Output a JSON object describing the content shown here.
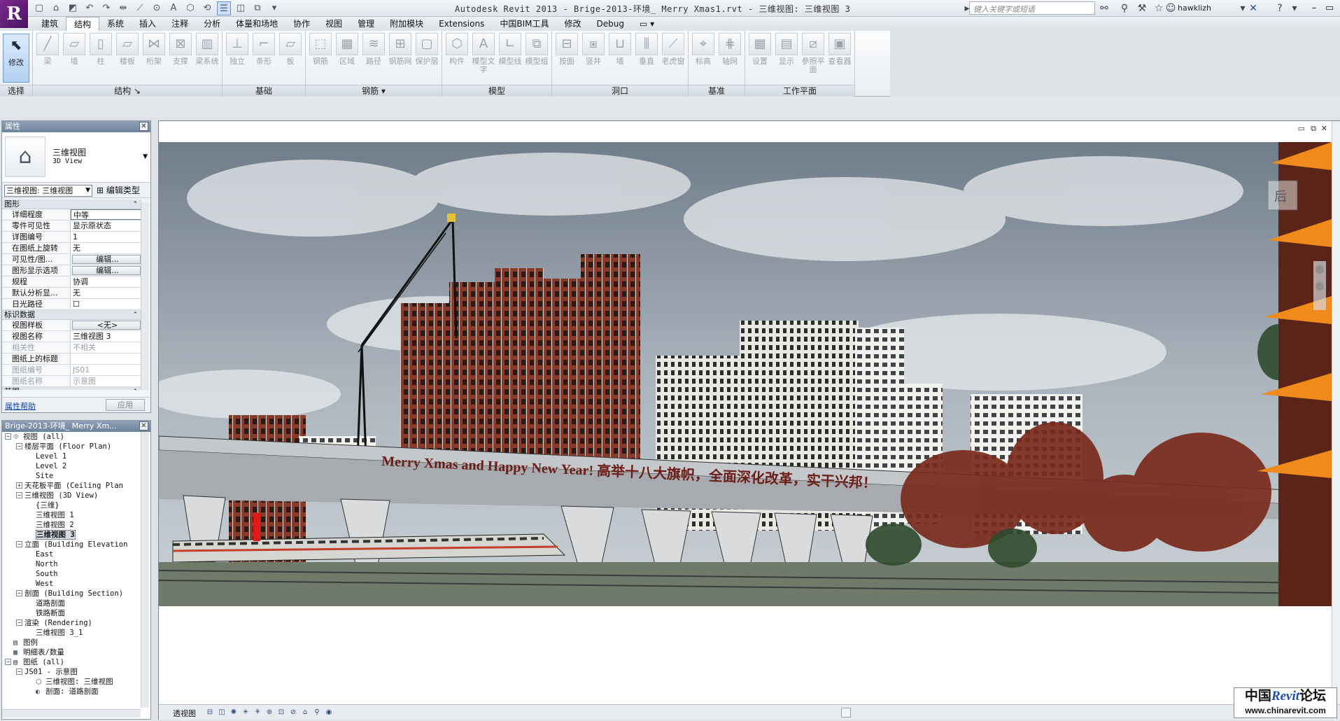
{
  "title_bar": {
    "logo_glyph": "R",
    "title": "Autodesk Revit 2013 -    Brige-2013-环境_ Merry Xmas1.rvt - 三维视图: 三维视图 3",
    "search_placeholder": "键入关键字或短语",
    "user": "hawklizh",
    "qat_icons": [
      "new-icon",
      "open-icon",
      "save-icon",
      "undo-icon",
      "redo-icon",
      "measure-icon",
      "text-icon",
      "3d-view-icon",
      "section-icon",
      "thin-lines-icon",
      "switch-windows-icon"
    ]
  },
  "ribbon_tabs": [
    "建筑",
    "结构",
    "系统",
    "插入",
    "注释",
    "分析",
    "体量和场地",
    "协作",
    "视图",
    "管理",
    "附加模块",
    "Extensions",
    "中国BIM工具",
    "修改",
    "Debug",
    "▭ ▾"
  ],
  "active_tab": "结构",
  "panels": [
    {
      "title": "选择",
      "tools": [
        {
          "label": "修改",
          "glyph": "⬉"
        }
      ]
    },
    {
      "title": "结构 ↘",
      "tools": [
        {
          "label": "梁",
          "glyph": "╱"
        },
        {
          "label": "墙",
          "glyph": "▱"
        },
        {
          "label": "柱",
          "glyph": "▯"
        },
        {
          "label": "楼板",
          "glyph": "▱"
        },
        {
          "label": "桁架",
          "glyph": "⋈"
        },
        {
          "label": "支撑",
          "glyph": "⊠"
        },
        {
          "label": "梁系统",
          "glyph": "▥"
        }
      ]
    },
    {
      "title": "基础",
      "tools": [
        {
          "label": "独立",
          "glyph": "⊥"
        },
        {
          "label": "条形",
          "glyph": "⌐"
        },
        {
          "label": "板",
          "glyph": "▱"
        }
      ]
    },
    {
      "title": "钢筋 ▾",
      "tools": [
        {
          "label": "钢筋",
          "glyph": "⬚"
        },
        {
          "label": "区域",
          "glyph": "▦"
        },
        {
          "label": "路径",
          "glyph": "≋"
        },
        {
          "label": "钢筋网",
          "glyph": "⊞"
        },
        {
          "label": "保护层",
          "glyph": "▢"
        }
      ]
    },
    {
      "title": "模型",
      "tools": [
        {
          "label": "构件",
          "glyph": "⬡"
        },
        {
          "label": "模型文字",
          "glyph": "A"
        },
        {
          "label": "模型线",
          "glyph": "∟"
        },
        {
          "label": "模型组",
          "glyph": "⧉"
        }
      ]
    },
    {
      "title": "洞口",
      "tools": [
        {
          "label": "按面",
          "glyph": "⊟"
        },
        {
          "label": "竖井",
          "glyph": "⧆"
        },
        {
          "label": "墙",
          "glyph": "⊔"
        },
        {
          "label": "垂直",
          "glyph": "⫼"
        },
        {
          "label": "老虎窗",
          "glyph": "⟋"
        }
      ]
    },
    {
      "title": "基准",
      "tools": [
        {
          "label": "标高",
          "glyph": "⌖"
        },
        {
          "label": "轴网",
          "glyph": "⋕"
        }
      ]
    },
    {
      "title": "工作平面",
      "tools": [
        {
          "label": "设置",
          "glyph": "▦"
        },
        {
          "label": "显示",
          "glyph": "▤"
        },
        {
          "label": "参照平面",
          "glyph": "⧄"
        },
        {
          "label": "查看器",
          "glyph": "▣"
        }
      ]
    }
  ],
  "properties": {
    "header": "属性",
    "type_name": "三维视图",
    "type_sub": "3D View",
    "view_select": "三维视图: 三维视图",
    "edit_type": "编辑类型",
    "sections": [
      {
        "name": "图形",
        "rows": [
          {
            "name": "详细程度",
            "value": "中等",
            "style": "edit"
          },
          {
            "name": "零件可见性",
            "value": "显示原状态"
          },
          {
            "name": "详图编号",
            "value": "1"
          },
          {
            "name": "在图纸上旋转",
            "value": "无"
          },
          {
            "name": "可见性/图...",
            "value": "编辑...",
            "style": "btn"
          },
          {
            "name": "图形显示选项",
            "value": "编辑...",
            "style": "btn"
          },
          {
            "name": "规程",
            "value": "协调"
          },
          {
            "name": "默认分析显...",
            "value": "无"
          },
          {
            "name": "日光路径",
            "value": "☐"
          }
        ]
      },
      {
        "name": "标识数据",
        "rows": [
          {
            "name": "视图样板",
            "value": "<无>",
            "style": "btn"
          },
          {
            "name": "视图名称",
            "value": "三维视图 3"
          },
          {
            "name": "相关性",
            "value": "不相关",
            "style": "grey"
          },
          {
            "name": "图纸上的标题",
            "value": ""
          },
          {
            "name": "图纸编号",
            "value": "JS01",
            "style": "grey"
          },
          {
            "name": "图纸名称",
            "value": "示意图",
            "style": "grey"
          }
        ]
      },
      {
        "name": "范围",
        "rows": []
      }
    ],
    "help_link": "属性帮助",
    "apply": "应用"
  },
  "browser": {
    "header": "Brige-2013-环境_ Merry Xm...",
    "tree": [
      {
        "indent": 0,
        "toggle": "−",
        "icon": "⟐",
        "text": "视图 (all)"
      },
      {
        "indent": 1,
        "toggle": "−",
        "icon": "",
        "text": "楼层平面 (Floor Plan)"
      },
      {
        "indent": 2,
        "toggle": "",
        "icon": "",
        "text": "Level 1"
      },
      {
        "indent": 2,
        "toggle": "",
        "icon": "",
        "text": "Level 2"
      },
      {
        "indent": 2,
        "toggle": "",
        "icon": "",
        "text": "Site"
      },
      {
        "indent": 1,
        "toggle": "+",
        "icon": "",
        "text": "天花板平面 (Ceiling Plan"
      },
      {
        "indent": 1,
        "toggle": "−",
        "icon": "",
        "text": "三维视图 (3D View)"
      },
      {
        "indent": 2,
        "toggle": "",
        "icon": "",
        "text": "{三维}"
      },
      {
        "indent": 2,
        "toggle": "",
        "icon": "",
        "text": "三维视图 1"
      },
      {
        "indent": 2,
        "toggle": "",
        "icon": "",
        "text": "三维视图 2"
      },
      {
        "indent": 2,
        "toggle": "",
        "icon": "",
        "text": "三维视图 3",
        "selected": true
      },
      {
        "indent": 1,
        "toggle": "−",
        "icon": "",
        "text": "立面 (Building Elevation"
      },
      {
        "indent": 2,
        "toggle": "",
        "icon": "",
        "text": "East"
      },
      {
        "indent": 2,
        "toggle": "",
        "icon": "",
        "text": "North"
      },
      {
        "indent": 2,
        "toggle": "",
        "icon": "",
        "text": "South"
      },
      {
        "indent": 2,
        "toggle": "",
        "icon": "",
        "text": "West"
      },
      {
        "indent": 1,
        "toggle": "−",
        "icon": "",
        "text": "剖面 (Building Section)"
      },
      {
        "indent": 2,
        "toggle": "",
        "icon": "",
        "text": "道路剖面"
      },
      {
        "indent": 2,
        "toggle": "",
        "icon": "",
        "text": "铁路断面"
      },
      {
        "indent": 1,
        "toggle": "−",
        "icon": "",
        "text": "渲染 (Rendering)"
      },
      {
        "indent": 2,
        "toggle": "",
        "icon": "",
        "text": "三维视图 3_1"
      },
      {
        "indent": 0,
        "toggle": "",
        "icon": "▤",
        "text": "图例"
      },
      {
        "indent": 0,
        "toggle": "",
        "icon": "▦",
        "text": "明细表/数量"
      },
      {
        "indent": 0,
        "toggle": "−",
        "icon": "▤",
        "text": "图纸 (all)"
      },
      {
        "indent": 1,
        "toggle": "−",
        "icon": "",
        "text": "JS01 - 示意图"
      },
      {
        "indent": 2,
        "toggle": "",
        "icon": "⬡",
        "text": "三维视图: 三维视图"
      },
      {
        "indent": 2,
        "toggle": "",
        "icon": "◐",
        "text": "剖面: 道路剖面"
      }
    ]
  },
  "view": {
    "banner": "Merry Xmas and Happy New Year! 高举十八大旗帜，全面深化改革，实干兴邦！",
    "view_cube_label": "后",
    "status_view_name": "透视图",
    "status_icons": [
      "scale-icon",
      "detail-level-icon",
      "visual-style-icon",
      "sun-path-icon",
      "shadows-icon",
      "render-icon",
      "crop-icon",
      "show-crop-icon",
      "lock-view-icon",
      "temp-hide-icon",
      "reveal-hidden-icon"
    ],
    "status_glyphs": [
      "⊟",
      "◫",
      "✺",
      "☀",
      "⚘",
      "⊛",
      "⊡",
      "⊘",
      "⌂",
      "⚲",
      "◉"
    ]
  },
  "watermark": {
    "title_a": "中国",
    "title_b": "Revit",
    "title_c": "论坛",
    "url": "www.chinarevit.com"
  }
}
